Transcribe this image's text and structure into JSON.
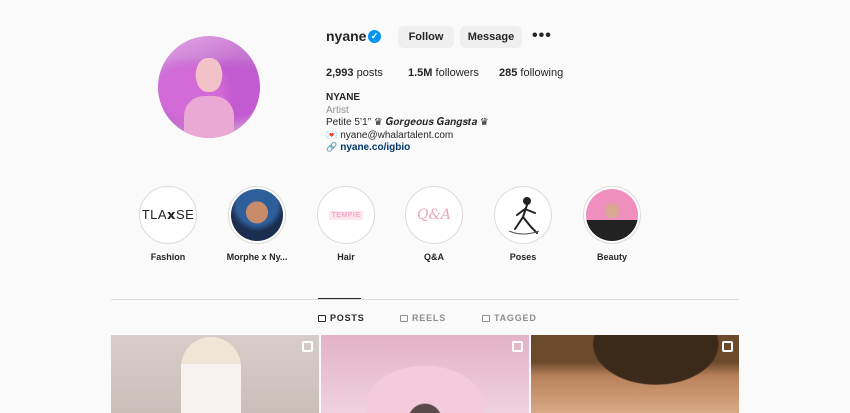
{
  "profile": {
    "username": "nyane",
    "follow_label": "Follow",
    "message_label": "Message",
    "more_label": "•••"
  },
  "stats": {
    "posts_count": "2,993",
    "posts_label": "posts",
    "followers_count": "1.5M",
    "followers_label": "followers",
    "following_count": "285",
    "following_label": "following"
  },
  "bio": {
    "name": "NYANE",
    "category": "Artist",
    "line1": "Petite 5’1” ♛ 𝑮𝒐𝒓𝒈𝒆𝒐𝒖𝒔 𝑮𝒂𝒏𝒈𝒔𝒕𝒂 ♛",
    "email_icon": "💌",
    "email": "nyane@whalartalent.com",
    "link": "nyane.co/igbio"
  },
  "highlights": [
    {
      "label": "Fashion",
      "cover_text": "TLA𝘅SE"
    },
    {
      "label": "Morphe x Ny..."
    },
    {
      "label": "Hair",
      "cover_text": "TEMPIE"
    },
    {
      "label": "Q&A",
      "cover_text": "Q&A"
    },
    {
      "label": "Poses"
    },
    {
      "label": "Beauty"
    }
  ],
  "tabs": [
    {
      "label": "POSTS",
      "active": true
    },
    {
      "label": "REELS",
      "active": false
    },
    {
      "label": "TAGGED",
      "active": false
    }
  ],
  "colors": {
    "verified_blue": "#0095f6",
    "link_blue": "#00376b",
    "button_gray": "#efefef"
  }
}
